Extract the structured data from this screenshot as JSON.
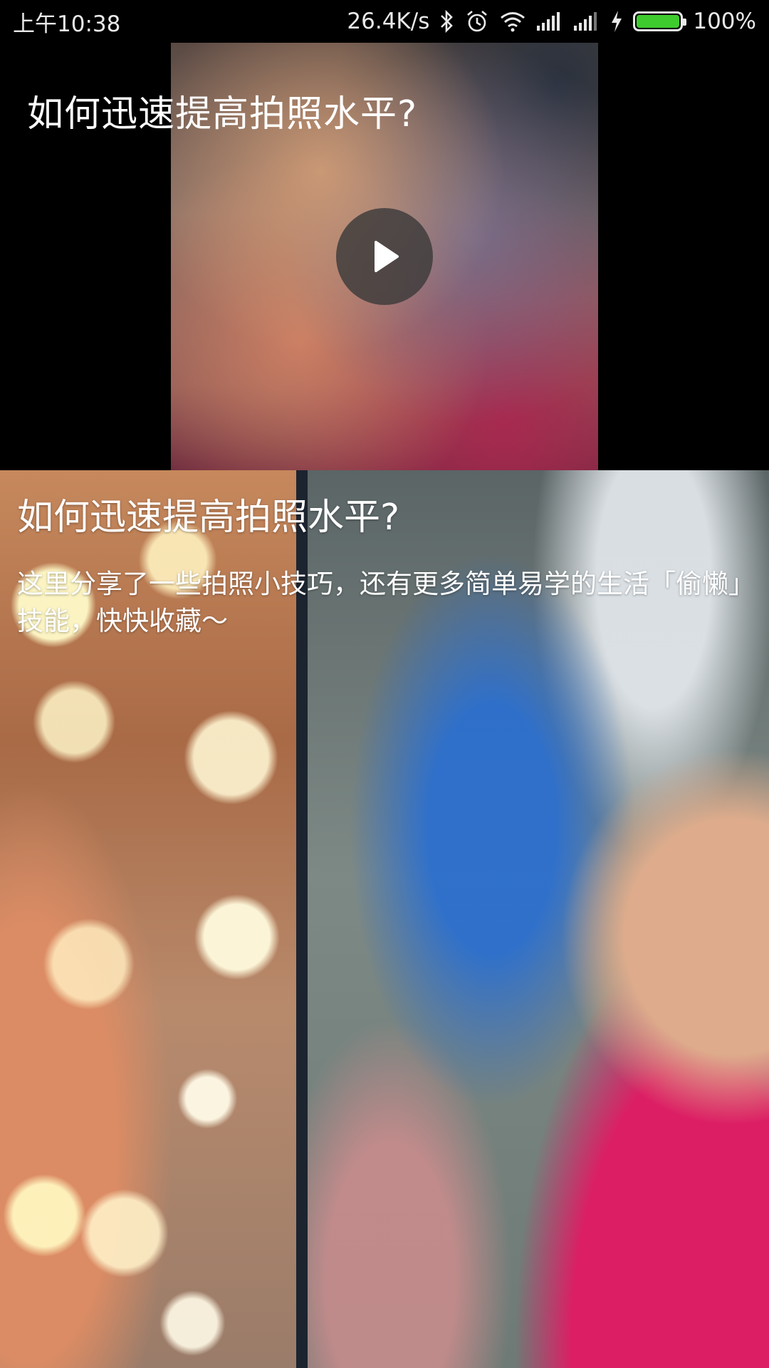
{
  "status_bar": {
    "time": "上午10:38",
    "network_speed": "26.4K/s",
    "battery_percent": "100%",
    "battery_level": 1.0,
    "battery_color": "#3ecb2e",
    "icons": [
      "bluetooth-icon",
      "alarm-icon",
      "wifi-icon",
      "signal-icon",
      "signal-icon",
      "charging-icon",
      "battery-icon"
    ]
  },
  "video": {
    "title": "如何迅速提高拍照水平?",
    "play_icon": "play-icon"
  },
  "article": {
    "title": "如何迅速提高拍照水平?",
    "description": "这里分享了一些拍照小技巧，还有更多简单易学的生活「偷懒」技能，快快收藏～"
  }
}
